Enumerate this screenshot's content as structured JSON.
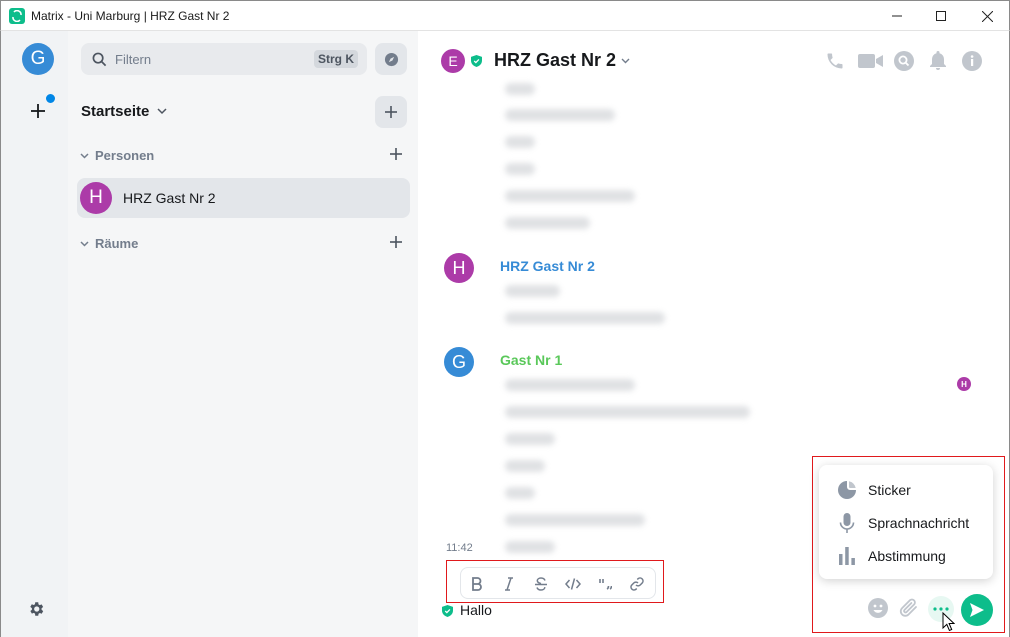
{
  "window": {
    "title": "Matrix - Uni Marburg | HRZ Gast Nr 2"
  },
  "spacebar": {
    "user_initial": "G"
  },
  "roomlist": {
    "filter_placeholder": "Filtern",
    "filter_shortcut": "Strg K",
    "home_title": "Startseite",
    "sections": [
      {
        "label": "Personen"
      },
      {
        "label": "Räume"
      }
    ],
    "rooms": [
      {
        "initial": "H",
        "name": "HRZ Gast Nr 2"
      }
    ]
  },
  "room_header": {
    "avatar_initial": "E",
    "name": "HRZ Gast Nr 2"
  },
  "timeline": {
    "senders": [
      {
        "initial": "H",
        "name": "HRZ Gast Nr 2",
        "color": "#368bd6",
        "avatar_color": "#ac3ba8"
      },
      {
        "initial": "G",
        "name": "Gast Nr 1",
        "color": "#5ac85a",
        "avatar_color": "#368bd6"
      }
    ],
    "read_receipt_initial": "H",
    "timestamp": "11:42"
  },
  "composer": {
    "text": "Hallo",
    "format_buttons": [
      "bold",
      "italic",
      "strikethrough",
      "code",
      "quote",
      "link"
    ]
  },
  "more_menu": {
    "items": [
      {
        "label": "Sticker",
        "icon": "sticker-icon"
      },
      {
        "label": "Sprachnachricht",
        "icon": "microphone-icon"
      },
      {
        "label": "Abstimmung",
        "icon": "poll-icon"
      }
    ]
  },
  "colors": {
    "accent": "#0dbd8b",
    "highlight_outline": "#e0191c"
  }
}
